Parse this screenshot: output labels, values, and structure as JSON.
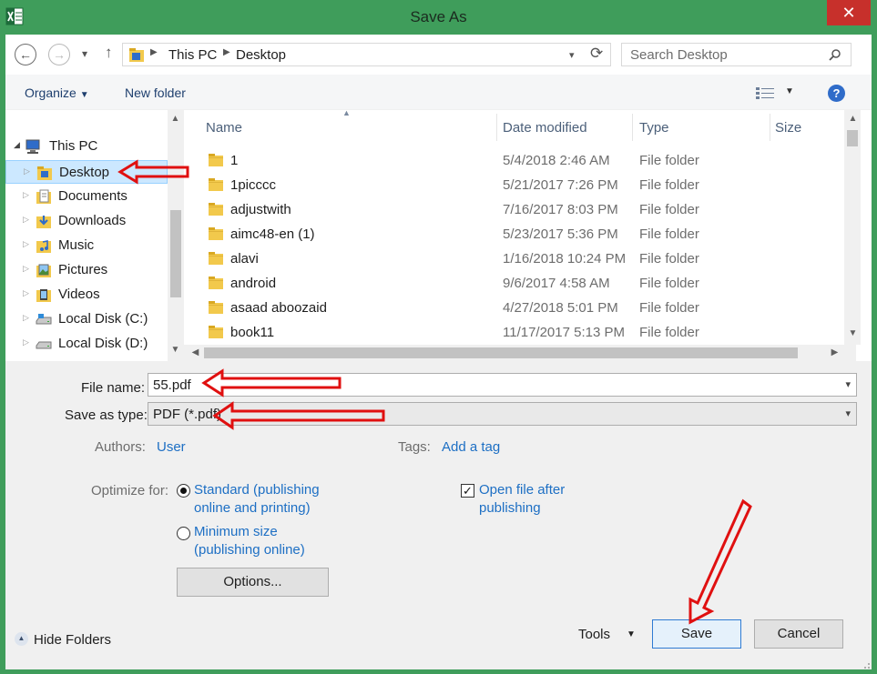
{
  "window": {
    "title": "Save As",
    "close_glyph": "✕"
  },
  "address": {
    "crumbs": [
      "This PC",
      "Desktop"
    ],
    "search_placeholder": "Search Desktop"
  },
  "toolbar": {
    "organize": "Organize",
    "new_folder": "New folder"
  },
  "nav": {
    "items": [
      {
        "label": "This PC",
        "icon": "computer-icon"
      },
      {
        "label": "Desktop",
        "icon": "desktop-folder-icon"
      },
      {
        "label": "Documents",
        "icon": "documents-icon"
      },
      {
        "label": "Downloads",
        "icon": "downloads-icon"
      },
      {
        "label": "Music",
        "icon": "music-icon"
      },
      {
        "label": "Pictures",
        "icon": "pictures-icon"
      },
      {
        "label": "Videos",
        "icon": "videos-icon"
      },
      {
        "label": "Local Disk (C:)",
        "icon": "drive-icon"
      },
      {
        "label": "Local Disk (D:)",
        "icon": "drive-icon"
      }
    ]
  },
  "files": {
    "columns": [
      "Name",
      "Date modified",
      "Type",
      "Size"
    ],
    "rows": [
      {
        "name": "1",
        "date": "5/4/2018 2:46 AM",
        "type": "File folder"
      },
      {
        "name": "1picccc",
        "date": "5/21/2017 7:26 PM",
        "type": "File folder"
      },
      {
        "name": "adjustwith",
        "date": "7/16/2017 8:03 PM",
        "type": "File folder"
      },
      {
        "name": "aimc48-en (1)",
        "date": "5/23/2017 5:36 PM",
        "type": "File folder"
      },
      {
        "name": "alavi",
        "date": "1/16/2018 10:24 PM",
        "type": "File folder"
      },
      {
        "name": "android",
        "date": "9/6/2017 4:58 AM",
        "type": "File folder"
      },
      {
        "name": "asaad aboozaid",
        "date": "4/27/2018 5:01 PM",
        "type": "File folder"
      },
      {
        "name": "book11",
        "date": "11/17/2017 5:13 PM",
        "type": "File folder"
      }
    ]
  },
  "form": {
    "file_name_label": "File name:",
    "file_name_value": "55.pdf",
    "save_type_label": "Save as type:",
    "save_type_value": "PDF (*.pdf)",
    "authors_label": "Authors:",
    "authors_value": "User",
    "tags_label": "Tags:",
    "tags_value": "Add a tag",
    "optimize_label": "Optimize for:",
    "opt_standard_line1": "Standard (publishing",
    "opt_standard_line2": "online and printing)",
    "opt_minimum_line1": "Minimum size",
    "opt_minimum_line2": "(publishing online)",
    "open_after_line1": "Open file after",
    "open_after_line2": "publishing",
    "open_after_checked": true,
    "optimize_selected": "standard",
    "options_button": "Options..."
  },
  "footer": {
    "hide_folders": "Hide Folders",
    "tools": "Tools",
    "save": "Save",
    "cancel": "Cancel"
  },
  "colors": {
    "frame": "#3f9d5b",
    "close": "#c7302b",
    "link": "#1d6fc4",
    "annotation_arrow": "#e01010",
    "folder": "#f2c94c"
  }
}
